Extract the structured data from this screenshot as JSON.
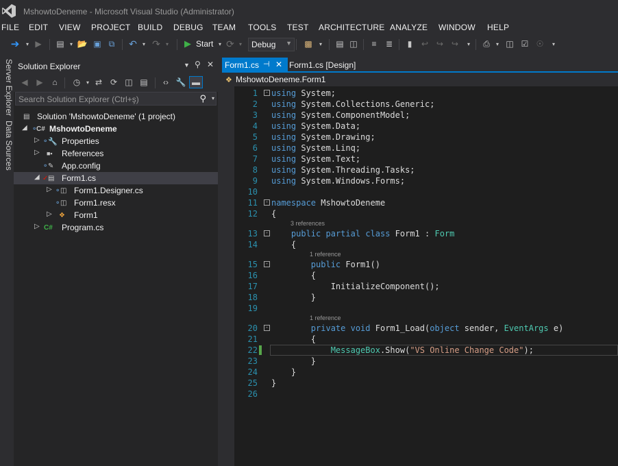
{
  "window": {
    "title": "MshowtoDeneme - Microsoft Visual Studio (Administrator)"
  },
  "menu": [
    "FILE",
    "EDIT",
    "VIEW",
    "PROJECT",
    "BUILD",
    "DEBUG",
    "TEAM",
    "TOOLS",
    "TEST",
    "ARCHITECTURE",
    "ANALYZE",
    "WINDOW",
    "HELP"
  ],
  "toolbar": {
    "start_label": "Start",
    "configuration": "Debug"
  },
  "side_tabs": [
    "Server Explorer",
    "Data Sources"
  ],
  "solution_explorer": {
    "title": "Solution Explorer",
    "search_placeholder": "Search Solution Explorer (Ctrl+ş)",
    "tree": [
      {
        "label": "Solution 'MshowtoDeneme' (1 project)",
        "icon": "solution-icon",
        "depth": 0
      },
      {
        "label": "MshowtoDeneme",
        "icon": "csharp-project-icon",
        "depth": 1,
        "bold": true
      },
      {
        "label": "Properties",
        "icon": "wrench-icon",
        "depth": 2
      },
      {
        "label": "References",
        "icon": "references-icon",
        "depth": 2
      },
      {
        "label": "App.config",
        "icon": "config-file-icon",
        "depth": 2
      },
      {
        "label": "Form1.cs",
        "icon": "form-icon",
        "depth": 2,
        "selected": true
      },
      {
        "label": "Form1.Designer.cs",
        "icon": "cs-file-icon",
        "depth": 3
      },
      {
        "label": "Form1.resx",
        "icon": "resx-file-icon",
        "depth": 3
      },
      {
        "label": "Form1",
        "icon": "class-icon",
        "depth": 3
      },
      {
        "label": "Program.cs",
        "icon": "csharp-file-icon",
        "depth": 2
      }
    ]
  },
  "editor": {
    "tabs": [
      {
        "label": "Form1.cs",
        "active": true
      },
      {
        "label": "Form1.cs [Design]",
        "active": false
      }
    ],
    "navigation": "MshowtoDeneme.Form1",
    "lines": [
      {
        "n": "1",
        "code": "using System;"
      },
      {
        "n": "2",
        "code": "using System.Collections.Generic;"
      },
      {
        "n": "3",
        "code": "using System.ComponentModel;"
      },
      {
        "n": "4",
        "code": "using System.Data;"
      },
      {
        "n": "5",
        "code": "using System.Drawing;"
      },
      {
        "n": "6",
        "code": "using System.Linq;"
      },
      {
        "n": "7",
        "code": "using System.Text;"
      },
      {
        "n": "8",
        "code": "using System.Threading.Tasks;"
      },
      {
        "n": "9",
        "code": "using System.Windows.Forms;"
      },
      {
        "n": "10",
        "code": ""
      },
      {
        "n": "11",
        "code": "namespace MshowtoDeneme"
      },
      {
        "n": "12",
        "code": "{"
      },
      {
        "n": "13",
        "code": "    public partial class Form1 : Form",
        "lens": "3 references"
      },
      {
        "n": "14",
        "code": "    {"
      },
      {
        "n": "15",
        "code": "        public Form1()",
        "lens": "1 reference"
      },
      {
        "n": "16",
        "code": "        {"
      },
      {
        "n": "17",
        "code": "            InitializeComponent();"
      },
      {
        "n": "18",
        "code": "        }"
      },
      {
        "n": "19",
        "code": ""
      },
      {
        "n": "20",
        "code": "        private void Form1_Load(object sender, EventArgs e)",
        "lens": "1 reference"
      },
      {
        "n": "21",
        "code": "        {"
      },
      {
        "n": "22",
        "code": "            MessageBox.Show(\"VS Online Change Code\");"
      },
      {
        "n": "23",
        "code": "        }"
      },
      {
        "n": "24",
        "code": "    }"
      },
      {
        "n": "25",
        "code": "}"
      },
      {
        "n": "26",
        "code": ""
      }
    ]
  },
  "colors": {
    "accent": "#007acc",
    "keyword": "#569cd6",
    "type": "#4ec9b0",
    "string": "#d69d85",
    "line_number": "#2b91af",
    "change_marker": "#57a64a"
  }
}
